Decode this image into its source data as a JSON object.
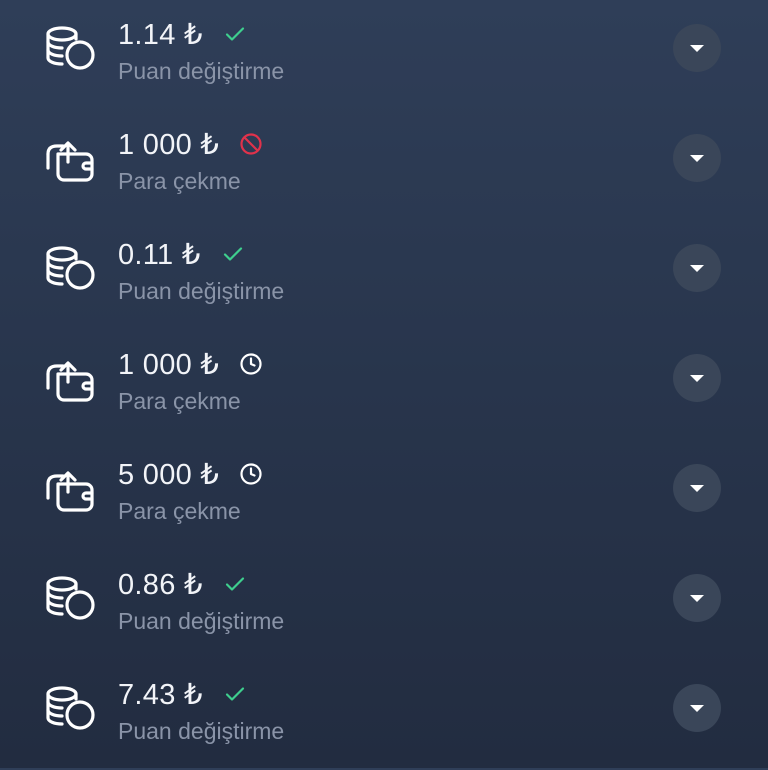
{
  "currency_symbol": "₺",
  "colors": {
    "status_done": "#3ecf8e",
    "status_rejected": "#e0324b",
    "status_pending": "#ffffff"
  },
  "transactions": [
    {
      "amount": "1.14 ₺",
      "label": "Puan değiştirme",
      "icon": "coins-icon",
      "status": "done"
    },
    {
      "amount": "1 000 ₺",
      "label": "Para çekme",
      "icon": "wallet-withdraw-icon",
      "status": "rejected"
    },
    {
      "amount": "0.11 ₺",
      "label": "Puan değiştirme",
      "icon": "coins-icon",
      "status": "done"
    },
    {
      "amount": "1 000 ₺",
      "label": "Para çekme",
      "icon": "wallet-withdraw-icon",
      "status": "pending"
    },
    {
      "amount": "5 000 ₺",
      "label": "Para çekme",
      "icon": "wallet-withdraw-icon",
      "status": "pending"
    },
    {
      "amount": "0.86 ₺",
      "label": "Puan değiştirme",
      "icon": "coins-icon",
      "status": "done"
    },
    {
      "amount": "7.43 ₺",
      "label": "Puan değiştirme",
      "icon": "coins-icon",
      "status": "done"
    }
  ]
}
